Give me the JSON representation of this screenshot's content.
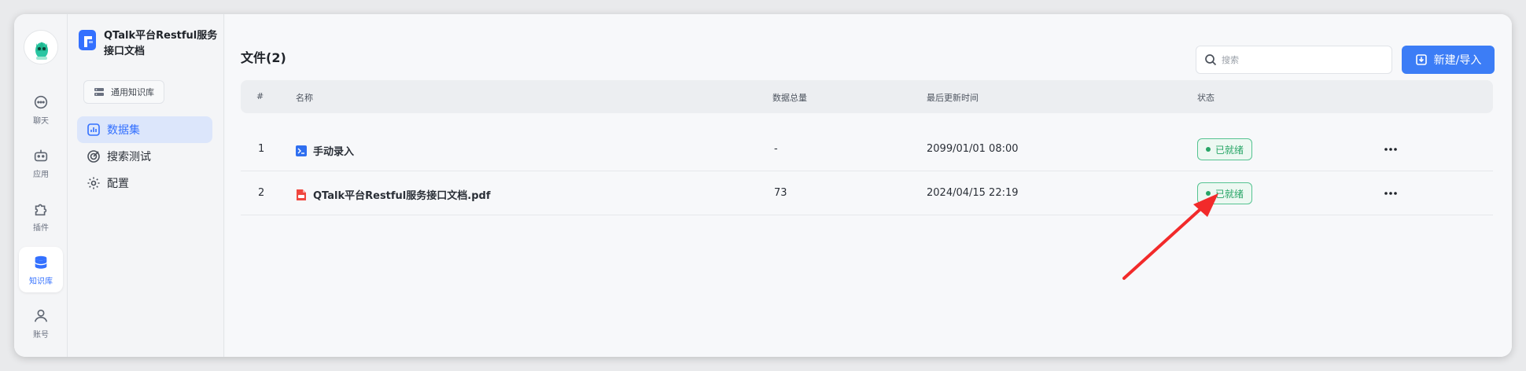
{
  "rail": {
    "items": [
      {
        "label": "聊天",
        "icon": "chat-icon"
      },
      {
        "label": "应用",
        "icon": "robot-icon"
      },
      {
        "label": "插件",
        "icon": "puzzle-icon"
      },
      {
        "label": "知识库",
        "icon": "database-icon"
      },
      {
        "label": "账号",
        "icon": "user-icon"
      }
    ],
    "active": "知识库"
  },
  "sidebar": {
    "kb_title": "QTalk平台Restful服务接口文档",
    "kb_tag": "通用知识库",
    "nav": [
      {
        "label": "数据集",
        "icon": "chart-icon"
      },
      {
        "label": "搜索测试",
        "icon": "target-icon"
      },
      {
        "label": "配置",
        "icon": "gear-icon"
      }
    ]
  },
  "main": {
    "title": "文件(2)",
    "search_placeholder": "搜索",
    "new_button": "新建/导入",
    "columns": [
      "#",
      "名称",
      "数据总量",
      "最后更新时间",
      "状态"
    ],
    "rows": [
      {
        "index": "1",
        "name": "手动录入",
        "file_icon": "manual-entry-icon",
        "count": "-",
        "updated": "2099/01/01 08:00",
        "status": "已就绪"
      },
      {
        "index": "2",
        "name": "QTalk平台Restful服务接口文档.pdf",
        "file_icon": "pdf-icon",
        "count": "73",
        "updated": "2024/04/15 22:19",
        "status": "已就绪"
      }
    ]
  },
  "colors": {
    "accent": "#3370ff",
    "status_green": "#27a566",
    "annotation_arrow": "#f22a2a"
  }
}
